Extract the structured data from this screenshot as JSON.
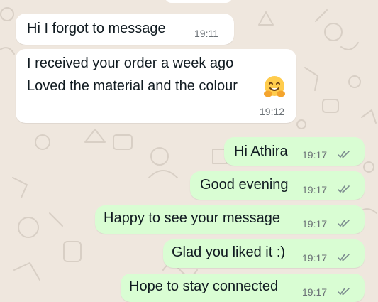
{
  "chat": {
    "messages": [
      {
        "direction": "incoming",
        "text": "Hi I forgot to message",
        "time": "19:11"
      },
      {
        "direction": "incoming",
        "lines": [
          "I received your order a week ago",
          "Loved the material and the colour"
        ],
        "emoji": "hugging-face",
        "time": "19:12"
      },
      {
        "direction": "outgoing",
        "text": "Hi Athira",
        "time": "19:17",
        "status": "read-double-tick"
      },
      {
        "direction": "outgoing",
        "text": "Good evening",
        "time": "19:17",
        "status": "read-double-tick"
      },
      {
        "direction": "outgoing",
        "text": "Happy to see your message",
        "time": "19:17",
        "status": "read-double-tick"
      },
      {
        "direction": "outgoing",
        "text": "Glad you liked it :)",
        "time": "19:17",
        "status": "read-double-tick"
      },
      {
        "direction": "outgoing",
        "text": "Hope to stay connected",
        "time": "19:17",
        "status": "read-double-tick"
      }
    ]
  },
  "colors": {
    "background": "#efe7de",
    "incoming_bubble": "#ffffff",
    "outgoing_bubble": "#d9fdd3",
    "timestamp": "#6b7176",
    "ticks": "#7c8b8f"
  }
}
